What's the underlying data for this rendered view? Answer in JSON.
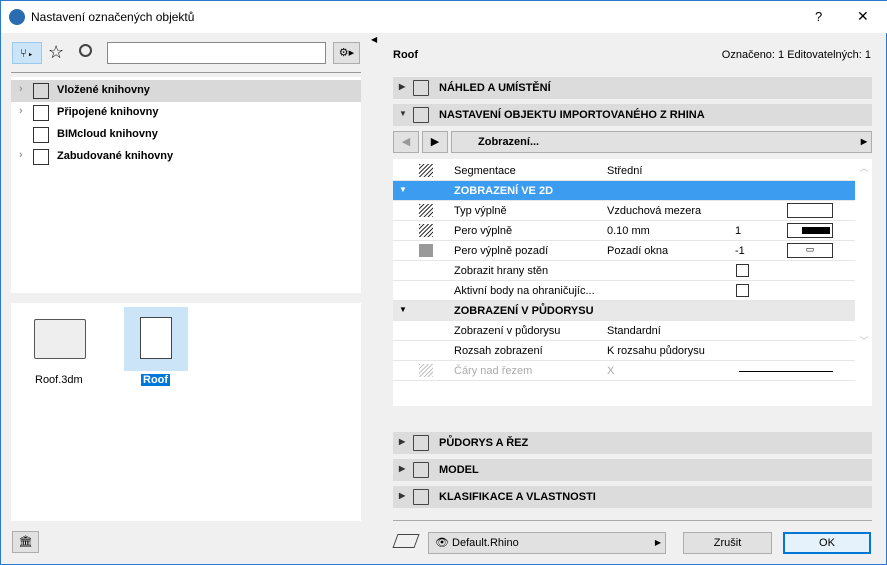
{
  "window": {
    "title": "Nastavení označených objektů",
    "help": "?",
    "close": "✕"
  },
  "library": {
    "tree": [
      {
        "label": "Vložené knihovny",
        "expand": true
      },
      {
        "label": "Připojené knihovny",
        "expand": true
      },
      {
        "label": "BIMcloud knihovny",
        "expand": false
      },
      {
        "label": "Zabudované knihovny",
        "expand": true
      }
    ],
    "search_value": "",
    "files": [
      {
        "label": "Roof.3dm"
      },
      {
        "label": "Roof"
      }
    ]
  },
  "panel": {
    "object": "Roof",
    "status": "Označeno: 1 Editovatelných: 1",
    "sections_top": [
      "NÁHLED A UMÍSTĚNÍ",
      "NASTAVENÍ OBJEKTU IMPORTOVANÉHO Z RHINA"
    ],
    "page_select": "Zobrazení...",
    "rows": [
      {
        "name": "Segmentace",
        "value": "Střední",
        "num": "",
        "type": "row"
      },
      {
        "name": "ZOBRAZENÍ VE 2D",
        "type": "sel"
      },
      {
        "name": "Typ výplně",
        "value": "Vzduchová mezera",
        "num": "",
        "type": "row"
      },
      {
        "name": "Pero výplně",
        "value": "0.10 mm",
        "num": "1",
        "type": "row"
      },
      {
        "name": "Pero výplně pozadí",
        "value": "Pozadí okna",
        "num": "-1",
        "type": "row"
      },
      {
        "name": "Zobrazit hrany stěn",
        "value": "",
        "num": "",
        "type": "row"
      },
      {
        "name": "Aktivní body na ohraničujíc...",
        "value": "",
        "num": "",
        "type": "row"
      },
      {
        "name": "ZOBRAZENÍ V PŮDORYSU",
        "type": "grp"
      },
      {
        "name": "Zobrazení v půdorysu",
        "value": "Standardní",
        "num": "",
        "type": "row"
      },
      {
        "name": "Rozsah zobrazení",
        "value": "K rozsahu půdorysu",
        "num": "",
        "type": "row"
      },
      {
        "name": "Čáry nad řezem",
        "value": "X",
        "num": "",
        "type": "row"
      }
    ],
    "sections_bottom": [
      "PŮDORYS A ŘEZ",
      "MODEL",
      "KLASIFIKACE A VLASTNOSTI"
    ],
    "view_select": "Default.Rhino",
    "cancel": "Zrušit",
    "ok": "OK"
  }
}
